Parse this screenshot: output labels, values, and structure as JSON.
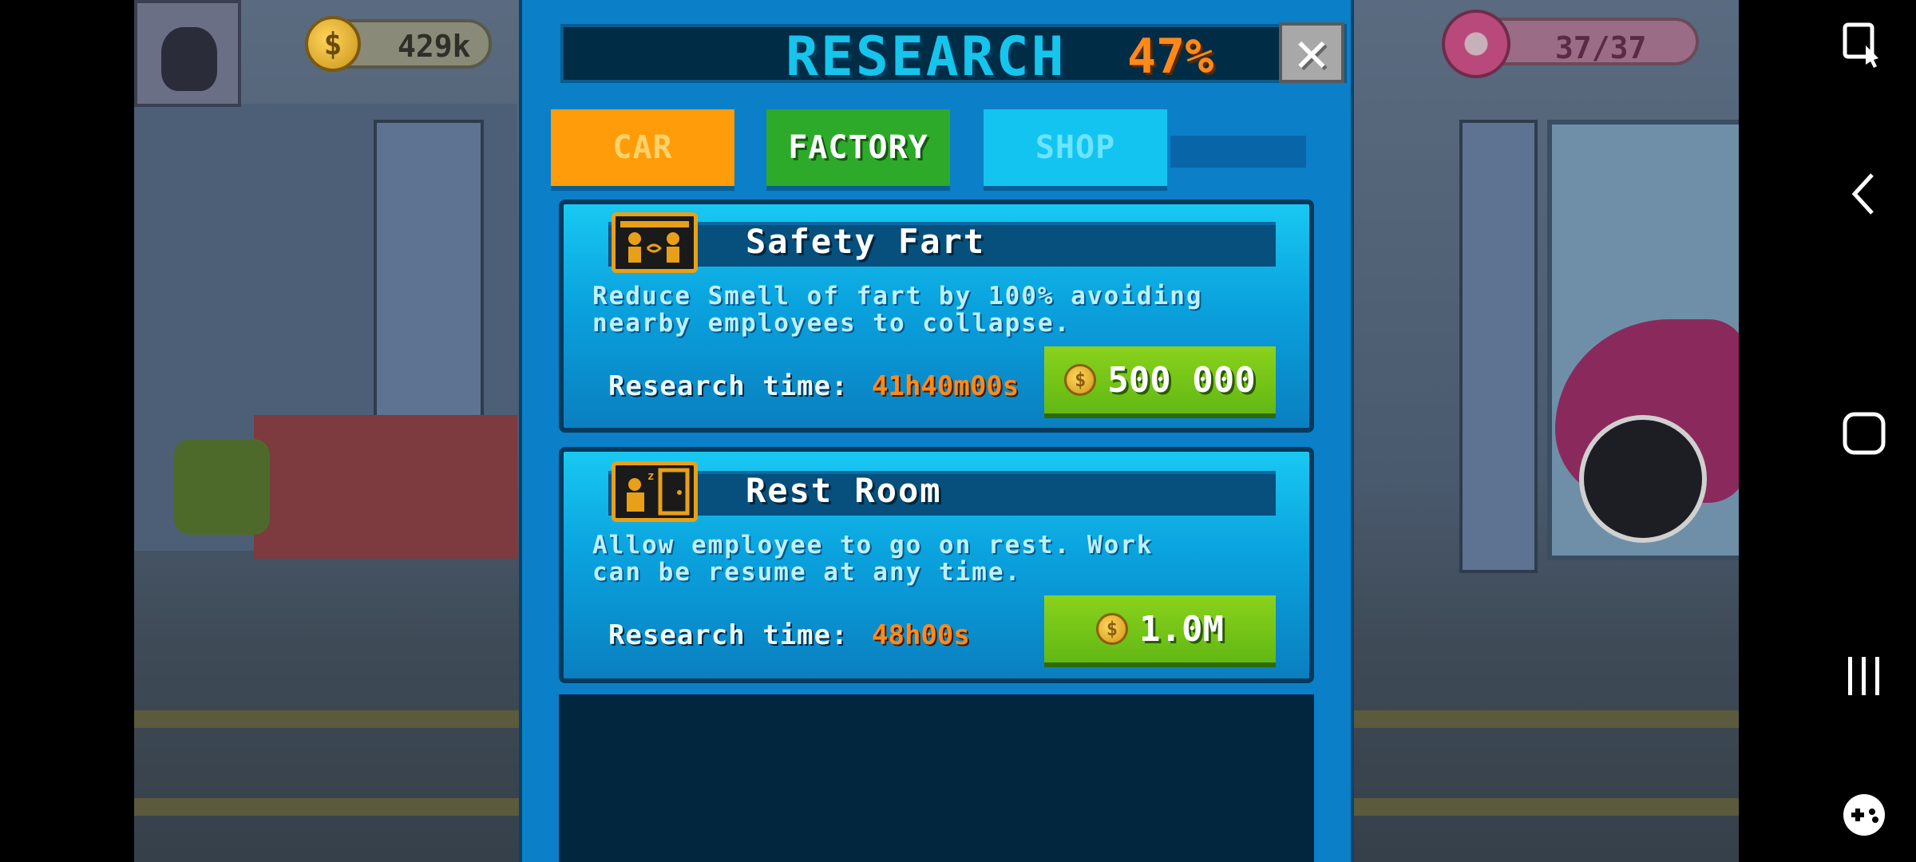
{
  "hud": {
    "money": "429k",
    "donuts": "37/37"
  },
  "research": {
    "title": "RESEARCH",
    "percent": "47%",
    "close_icon": "close-icon",
    "tabs": [
      {
        "label": "CAR",
        "color": "#ff9c0a"
      },
      {
        "label": "FACTORY",
        "color": "#2eaa2a"
      },
      {
        "label": "SHOP",
        "color": "#14c4f0"
      }
    ],
    "items": [
      {
        "title": "Safety Fart",
        "desc_line1": "Reduce Smell of fart by 100% avoiding",
        "desc_line2": "nearby employees to collapse.",
        "time_label": "Research time:",
        "time_value": "41h40m00s",
        "price": "500 000",
        "icon": "fart-icon"
      },
      {
        "title": "Rest Room",
        "desc_line1": "Allow employee to go on rest. Work",
        "desc_line2": "can be resume at any time.",
        "time_label": "Research time:",
        "time_value": "48h00s",
        "price": "1.0M",
        "icon": "rest-room-icon"
      }
    ]
  },
  "system_nav": {
    "icons": [
      "screenshot-tool-icon",
      "back-icon",
      "home-icon",
      "recents-icon",
      "game-tools-icon"
    ]
  }
}
